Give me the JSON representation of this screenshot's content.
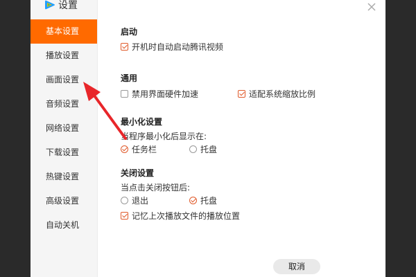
{
  "app": {
    "title": "设置",
    "logo": "tencent-video-logo"
  },
  "sidebar": {
    "items": [
      {
        "label": "基本设置",
        "active": true
      },
      {
        "label": "播放设置"
      },
      {
        "label": "画面设置"
      },
      {
        "label": "音频设置"
      },
      {
        "label": "网络设置"
      },
      {
        "label": "下载设置"
      },
      {
        "label": "热键设置"
      },
      {
        "label": "高级设置"
      },
      {
        "label": "自动关机"
      }
    ]
  },
  "sections": {
    "startup": {
      "title": "启动",
      "auto_start": {
        "label": "开机时自动启动腾讯视频",
        "checked": true
      }
    },
    "general": {
      "title": "通用",
      "disable_hw_accel": {
        "label": "禁用界面硬件加速",
        "checked": false
      },
      "fit_scaling": {
        "label": "适配系统缩放比例",
        "checked": true
      }
    },
    "minimize": {
      "title": "最小化设置",
      "prompt": "当程序最小化后显示在:",
      "options": [
        {
          "label": "任务栏",
          "checked": true
        },
        {
          "label": "托盘",
          "checked": false
        }
      ]
    },
    "close": {
      "title": "关闭设置",
      "prompt": "当点击关闭按钮后:",
      "options": [
        {
          "label": "退出",
          "checked": false
        },
        {
          "label": "托盘",
          "checked": true
        }
      ],
      "remember_position": {
        "label": "记忆上次播放文件的播放位置",
        "checked": true
      }
    }
  },
  "footer": {
    "cancel_label": "取消"
  },
  "colors": {
    "accent": "#ff6a00",
    "check": "#e05a2a",
    "arrow": "#e8262a"
  }
}
